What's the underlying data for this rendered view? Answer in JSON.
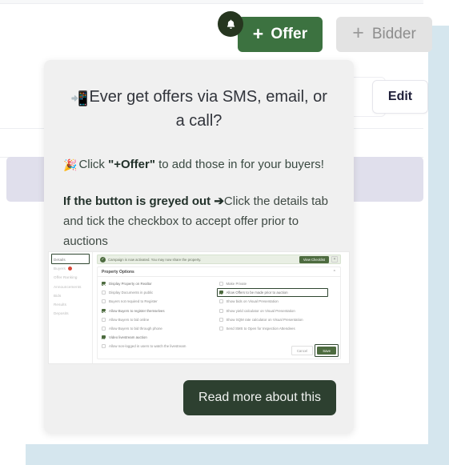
{
  "header": {
    "notification_icon": "bell-icon",
    "offer_button": {
      "plus": "+",
      "label": "Offer"
    },
    "bidder_button": {
      "plus": "+",
      "label": "Bidder"
    },
    "edit_button": "Edit"
  },
  "coach": {
    "title_emoji": "📲",
    "title": "Ever get offers via SMS, email, or a call?",
    "sub_emoji": "🎉",
    "sub_prefix": "Click ",
    "sub_strong": "\"+Offer\"",
    "sub_suffix": " to add those in for your buyers!",
    "body_strong": "If the button is greyed out",
    "body_arrow": "➔",
    "body_text": "Click the details tab and tick the checkbox to accept offer prior to auctions",
    "read_more": "Read more about this"
  },
  "screenshot": {
    "sidebar": [
      {
        "label": "Details",
        "active": true,
        "badge": false
      },
      {
        "label": "Buyers",
        "active": false,
        "badge": true
      },
      {
        "label": "Offer Ranking",
        "active": false,
        "badge": false
      },
      {
        "label": "Announcements",
        "active": false,
        "badge": false
      },
      {
        "label": "Bids",
        "active": false,
        "badge": false
      },
      {
        "label": "Results",
        "active": false,
        "badge": false
      },
      {
        "label": "Deposits",
        "active": false,
        "badge": false
      }
    ],
    "banner": {
      "check_icon": "✓",
      "message": "Campaign is now activated. You may now share the property.",
      "view_checklist": "View Checklist",
      "close_icon": "✕"
    },
    "panel_title": "Property Options",
    "collapse_icon": "⌃",
    "options_left": [
      {
        "label": "Display Property on Realtor",
        "checked": true
      },
      {
        "label": "Display Documents in public",
        "checked": false
      },
      {
        "label": "Buyers not required to Register",
        "checked": false
      },
      {
        "label": "Allow Buyers to register themselves",
        "checked": true
      },
      {
        "label": "Allow Buyers to bid online",
        "checked": false
      },
      {
        "label": "Allow Buyers to bid through phone",
        "checked": false
      },
      {
        "label": "Video livestream auction",
        "checked": true
      },
      {
        "label": "Allow non-logged in users to watch the livestream",
        "checked": false
      }
    ],
    "options_right": [
      {
        "label": "Make Private",
        "checked": false,
        "highlighted": false
      },
      {
        "label": "Allow Offers to be made prior to auction",
        "checked": true,
        "highlighted": true
      },
      {
        "label": "Show bids on Visual Presentation",
        "checked": false,
        "highlighted": false
      },
      {
        "label": "Show yield calculator on Visual Presentation",
        "checked": false,
        "highlighted": false
      },
      {
        "label": "Show SQM rate calculator on Visual Presentation",
        "checked": false,
        "highlighted": false
      },
      {
        "label": "Send SMS to Open for Inspection Attendees",
        "checked": false,
        "highlighted": false
      }
    ],
    "cancel_button": "Cancel",
    "save_button": "Save"
  },
  "colors": {
    "offer_green": "#3c7240",
    "dark_green": "#2d4030",
    "highlight_green": "#2f4630",
    "bidder_grey": "#e3e3e3",
    "card_grey": "#f0f0f0",
    "lavender": "#e0dfec",
    "light_blue": "#d5e6ee",
    "badge_red": "#d84a3a"
  }
}
